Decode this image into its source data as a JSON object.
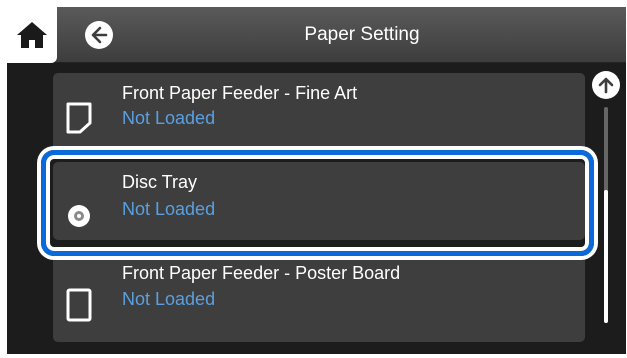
{
  "header": {
    "title": "Paper Setting"
  },
  "paper_sources": [
    {
      "name": "Front Paper Feeder - Fine Art",
      "status": "Not Loaded",
      "icon": "sheet-folded-corner-icon",
      "selected": false
    },
    {
      "name": "Disc Tray",
      "status": "Not Loaded",
      "icon": "disc-icon",
      "selected": true
    },
    {
      "name": "Front Paper Feeder - Poster Board",
      "status": "Not Loaded",
      "icon": "board-icon",
      "selected": false
    }
  ],
  "colors": {
    "accent": "#0a6ad9",
    "status_text": "#5aa0e0",
    "list_item_bg": "#3e3e3e",
    "screen_bg": "#1c1c1c"
  }
}
